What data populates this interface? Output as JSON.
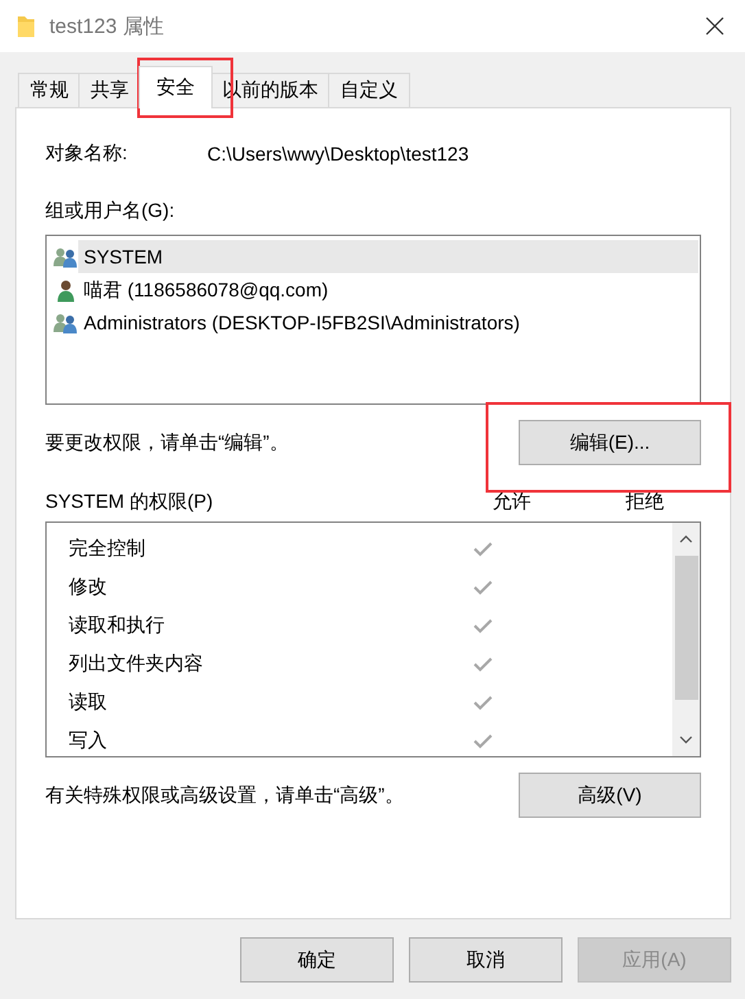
{
  "window": {
    "title": "test123 属性"
  },
  "tabs": [
    {
      "label": "常规",
      "selected": false,
      "highlighted": false
    },
    {
      "label": "共享",
      "selected": false,
      "highlighted": false
    },
    {
      "label": "安全",
      "selected": true,
      "highlighted": true
    },
    {
      "label": "以前的版本",
      "selected": false,
      "highlighted": false
    },
    {
      "label": "自定义",
      "selected": false,
      "highlighted": false
    }
  ],
  "object_name": {
    "label": "对象名称:",
    "value": "C:\\Users\\wwy\\Desktop\\test123"
  },
  "groups": {
    "label": "组或用户名(G):",
    "items": [
      {
        "kind": "group",
        "name": "SYSTEM",
        "selected": true
      },
      {
        "kind": "user",
        "name": "喵君 (1186586078@qq.com)",
        "selected": false
      },
      {
        "kind": "group",
        "name": "Administrators (DESKTOP-I5FB2SI\\Administrators)",
        "selected": false
      }
    ]
  },
  "edit_hint": "要更改权限，请单击“编辑”。",
  "edit_button": {
    "label": "编辑(E)...",
    "highlighted": true
  },
  "permissions": {
    "label": "SYSTEM 的权限(P)",
    "allow_label": "允许",
    "deny_label": "拒绝",
    "rows": [
      {
        "name": "完全控制",
        "allow": true,
        "deny": false
      },
      {
        "name": "修改",
        "allow": true,
        "deny": false
      },
      {
        "name": "读取和执行",
        "allow": true,
        "deny": false
      },
      {
        "name": "列出文件夹内容",
        "allow": true,
        "deny": false
      },
      {
        "name": "读取",
        "allow": true,
        "deny": false
      },
      {
        "name": "写入",
        "allow": true,
        "deny": false
      }
    ]
  },
  "advanced_hint": "有关特殊权限或高级设置，请单击“高级”。",
  "advanced_button": {
    "label": "高级(V)"
  },
  "buttons": [
    {
      "label": "确定",
      "disabled": false
    },
    {
      "label": "取消",
      "disabled": false
    },
    {
      "label": "应用(A)",
      "disabled": true
    }
  ]
}
